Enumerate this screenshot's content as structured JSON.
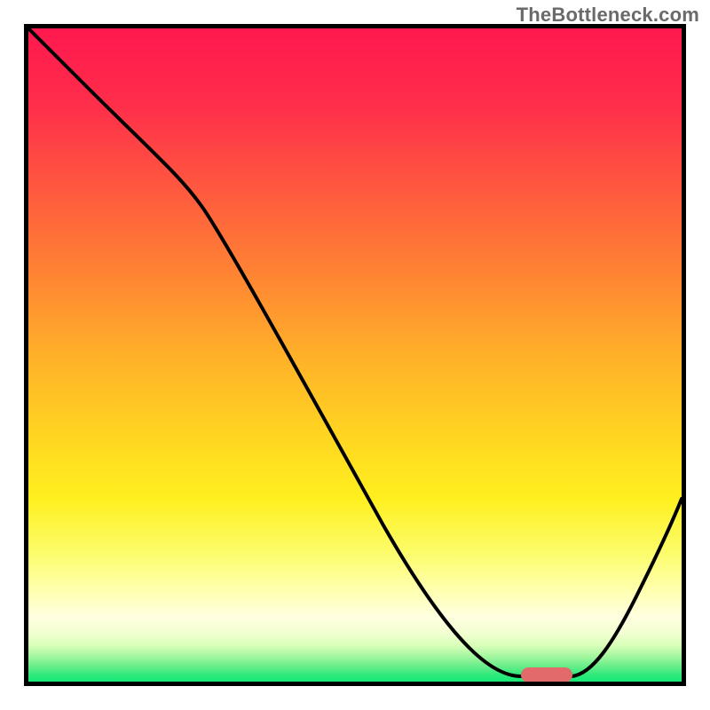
{
  "watermark": "TheBottleneck.com",
  "marker": {
    "label": "optimum-region",
    "color": "#e26a6a"
  },
  "colors": {
    "grad_top": "#ff184f",
    "grad_orange": "#ff8533",
    "grad_yellow": "#fff01f",
    "grad_pale": "#ffffe0",
    "grad_green": "#17e879",
    "curve": "#000000",
    "border": "#000000",
    "marker": "#e26a6a"
  },
  "chart_data": {
    "type": "line",
    "title": "",
    "xlabel": "",
    "ylabel": "",
    "xlim": [
      0,
      100
    ],
    "ylim": [
      0,
      100
    ],
    "legend": false,
    "grid": false,
    "series": [
      {
        "name": "bottleneck-curve",
        "x": [
          0,
          8,
          18,
          27,
          40,
          54,
          68,
          75,
          80,
          85,
          90,
          95,
          100
        ],
        "y": [
          100,
          92,
          81,
          73,
          50,
          24,
          6,
          1,
          1,
          1,
          12,
          22,
          28
        ]
      }
    ],
    "annotations": [
      {
        "name": "optimum-marker",
        "shape": "rounded-rect",
        "x_range": [
          75,
          83
        ],
        "y": 1,
        "color": "#e26a6a"
      }
    ],
    "background_gradient": {
      "direction": "vertical",
      "stops": [
        {
          "pos": 0.0,
          "color": "#ff184f"
        },
        {
          "pos": 0.25,
          "color": "#ff5a3f"
        },
        {
          "pos": 0.5,
          "color": "#ffb029"
        },
        {
          "pos": 0.72,
          "color": "#fff01f"
        },
        {
          "pos": 0.9,
          "color": "#ffffe0"
        },
        {
          "pos": 1.0,
          "color": "#17e879"
        }
      ]
    }
  }
}
